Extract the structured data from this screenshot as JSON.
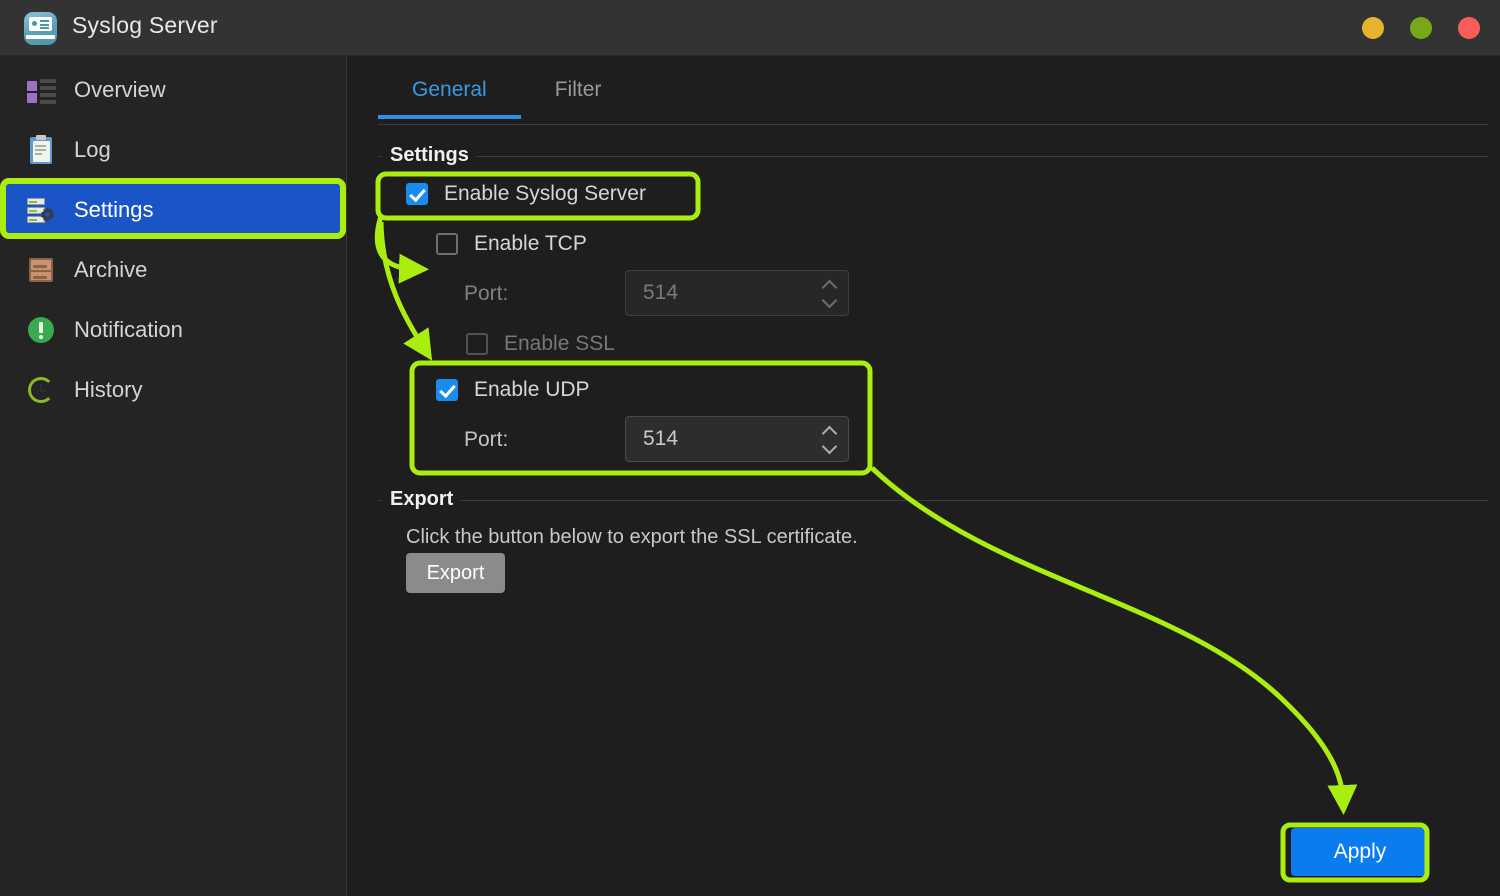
{
  "window": {
    "title": "Syslog Server",
    "app_icon": "syslog-server-icon",
    "controls": [
      {
        "name": "minimize",
        "color": "#e8b32c"
      },
      {
        "name": "maximize",
        "color": "#76a818"
      },
      {
        "name": "close",
        "color": "#fa5c5c"
      }
    ]
  },
  "sidebar": {
    "items": [
      {
        "label": "Overview",
        "icon": "overview-icon",
        "active": false
      },
      {
        "label": "Log",
        "icon": "log-icon",
        "active": false
      },
      {
        "label": "Settings",
        "icon": "settings-icon",
        "active": true
      },
      {
        "label": "Archive",
        "icon": "archive-icon",
        "active": false
      },
      {
        "label": "Notification",
        "icon": "notification-icon",
        "active": false
      },
      {
        "label": "History",
        "icon": "history-icon",
        "active": false
      }
    ]
  },
  "main": {
    "tabs": [
      {
        "label": "General",
        "active": true
      },
      {
        "label": "Filter",
        "active": false
      }
    ],
    "settings_group": {
      "title": "Settings",
      "enable_syslog": {
        "label": "Enable Syslog Server",
        "checked": true,
        "enabled": true
      },
      "enable_tcp": {
        "label": "Enable TCP",
        "checked": false,
        "enabled": true
      },
      "tcp_port": {
        "label": "Port:",
        "value": "514",
        "enabled": false
      },
      "enable_ssl": {
        "label": "Enable SSL",
        "checked": false,
        "enabled": false
      },
      "enable_udp": {
        "label": "Enable UDP",
        "checked": true,
        "enabled": true
      },
      "udp_port": {
        "label": "Port:",
        "value": "514",
        "enabled": true
      }
    },
    "export_group": {
      "title": "Export",
      "description": "Click the button below to export the SSL certificate.",
      "button_label": "Export"
    },
    "apply_label": "Apply"
  },
  "annotations": {
    "highlight_color": "#aaee11",
    "boxes": [
      {
        "name": "settings-nav-highlight"
      },
      {
        "name": "enable-syslog-highlight"
      },
      {
        "name": "udp-block-highlight"
      },
      {
        "name": "apply-highlight"
      }
    ],
    "arrows": [
      {
        "name": "arrow-to-enable-tcp"
      },
      {
        "name": "arrow-to-enable-udp"
      },
      {
        "name": "arrow-to-apply"
      }
    ]
  }
}
